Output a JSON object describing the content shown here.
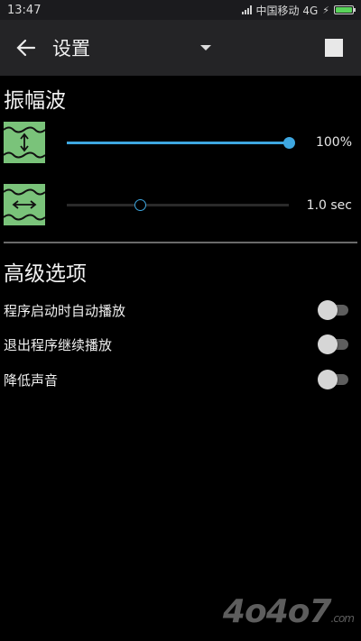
{
  "status_bar": {
    "time": "13:47",
    "carrier": "中国移动 4G",
    "battery_level": 1.0,
    "battery_color": "#59d45a"
  },
  "app_bar": {
    "title": "设置",
    "back_icon": "arrow-left-icon",
    "dropdown_icon": "caret-down-icon",
    "stop_icon": "stop-square-icon"
  },
  "sections": {
    "waveform": {
      "heading": "振幅波",
      "amplitude": {
        "icon": "wave-amplitude-icon",
        "value_text": "100%",
        "level": 1.0
      },
      "period": {
        "icon": "wave-period-icon",
        "value_text": "1.0 sec",
        "level": 0.33
      }
    },
    "advanced": {
      "heading": "高级选项",
      "options": [
        {
          "label": "程序启动时自动播放",
          "on": false
        },
        {
          "label": "退出程序继续播放",
          "on": false
        },
        {
          "label": "降低声音",
          "on": false
        }
      ]
    }
  },
  "colors": {
    "accent": "#3ea7e0",
    "icon_bg": "#7ac37a"
  },
  "watermark": {
    "text": "4o4o7",
    "suffix": ".com"
  }
}
